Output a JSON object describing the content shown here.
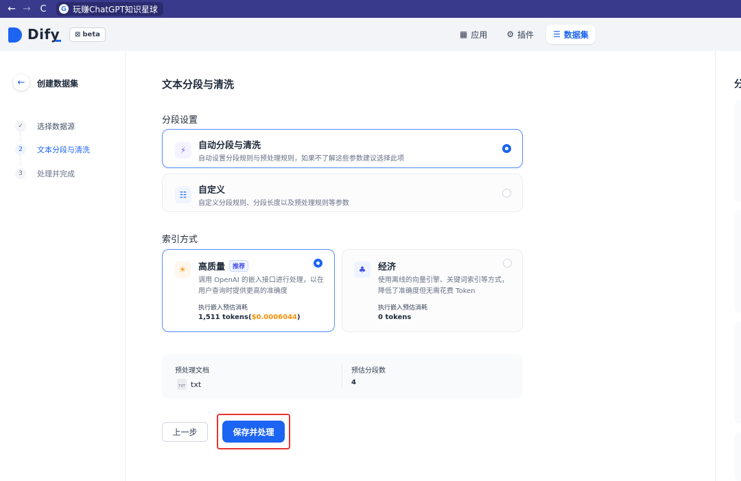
{
  "browser": {
    "back": "←",
    "forward": "→",
    "reload": "C",
    "tab_icon": "G",
    "tab_title": "玩赚ChatGPT知识星球"
  },
  "header": {
    "logo_text": "Dify",
    "beta_label": "beta",
    "beta_icon": "⊠",
    "nav": [
      {
        "icon": "▦",
        "label": "应用"
      },
      {
        "icon": "⚙",
        "label": "插件"
      },
      {
        "icon": "☰",
        "label": "数据集"
      }
    ]
  },
  "sidebar": {
    "back_icon": "←",
    "title": "创建数据集",
    "steps": [
      {
        "num": "✓",
        "label": "选择数据源"
      },
      {
        "num": "2",
        "label": "文本分段与清洗"
      },
      {
        "num": "3",
        "label": "处理并完成"
      }
    ]
  },
  "main": {
    "page_title": "文本分段与清洗",
    "segment_section": "分段设置",
    "segment_options": [
      {
        "icon": "⚡",
        "title": "自动分段与清洗",
        "desc": "自动设置分段规则与预处理规则，如果不了解这些参数建议选择此项"
      },
      {
        "icon": "☷",
        "title": "自定义",
        "desc": "自定义分段规则、分段长度以及预处理规则等参数"
      }
    ],
    "index_section": "索引方式",
    "index_options": [
      {
        "icon": "☀",
        "title": "高质量",
        "badge": "推荐",
        "desc": "调用 OpenAI 的嵌入接口进行处理，以在用户查询时提供更高的准确度",
        "cost_label": "执行嵌入预估消耗",
        "cost_tokens": "1,511 tokens(",
        "cost_price": "$0.0006044",
        "cost_close": ")"
      },
      {
        "icon": "♣",
        "title": "经济",
        "desc": "使用离线的向量引擎、关键词索引等方式，降低了准确度但无需花费 Token",
        "cost_label": "执行嵌入预估消耗",
        "cost_value": "0 tokens"
      }
    ],
    "preview": {
      "doc_label": "预处理文档",
      "doc_icon": "TXT",
      "doc_value": "txt",
      "segments_label": "预估分段数",
      "segments_value": "4"
    },
    "prev_button": "上一步",
    "save_button": "保存并处理"
  },
  "right_panel": {
    "title": "分段预览"
  },
  "colors": {
    "accent": "#1c64f2",
    "browser_bar": "#3a3a8c",
    "price": "#f79009",
    "highlight": "#e5322d"
  }
}
